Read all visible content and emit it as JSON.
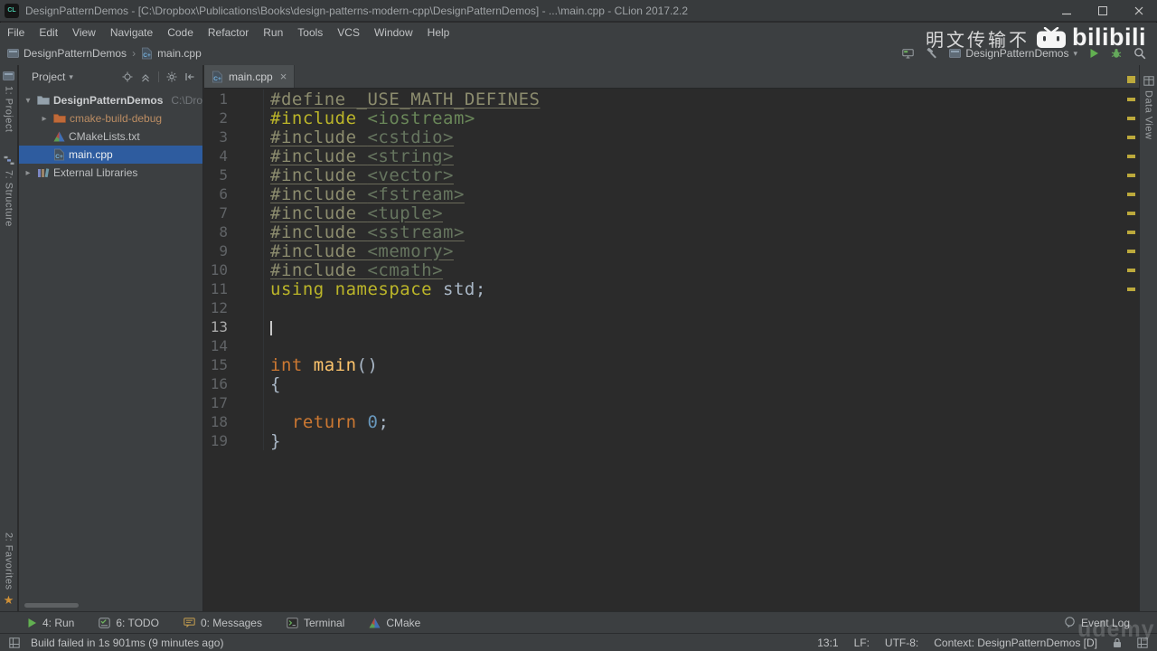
{
  "titlebar": {
    "app_icon_text": "CL",
    "title": "DesignPatternDemos - [C:\\Dropbox\\Publications\\Books\\design-patterns-modern-cpp\\DesignPatternDemos] - ...\\main.cpp - CLion 2017.2.2"
  },
  "menubar": {
    "items": [
      "File",
      "Edit",
      "View",
      "Navigate",
      "Code",
      "Refactor",
      "Run",
      "Tools",
      "VCS",
      "Window",
      "Help"
    ]
  },
  "navbar": {
    "breadcrumbs": [
      {
        "label": "DesignPatternDemos",
        "icon": "project"
      },
      {
        "label": "main.cpp",
        "icon": "cpp-file"
      }
    ],
    "run_config_label": "DesignPatternDemos"
  },
  "overlays": {
    "cjk_watermark": "明文传输不",
    "bilibili_text": "bilibili",
    "udemy_text": "udemy"
  },
  "tool_stripes": {
    "left": [
      {
        "label": "1: Project",
        "icon": "project"
      },
      {
        "label": "7: Structure",
        "icon": "structure"
      }
    ],
    "left_bottom": [
      {
        "label": "2: Favorites",
        "icon": "star"
      }
    ],
    "right": [
      {
        "label": "Data View",
        "icon": "dataview"
      }
    ]
  },
  "project_panel": {
    "title": "Project",
    "tree": [
      {
        "label": "DesignPatternDemos",
        "hint": "C:\\Drop",
        "icon": "folder",
        "arrow": "expanded",
        "indent": 0,
        "bold": true
      },
      {
        "label": "cmake-build-debug",
        "icon": "folder-excluded",
        "arrow": "collapsed",
        "indent": 1,
        "label_color": "#bc8d63"
      },
      {
        "label": "CMakeLists.txt",
        "icon": "cmake",
        "arrow": "none",
        "indent": 1
      },
      {
        "label": "main.cpp",
        "icon": "cpp-file",
        "arrow": "none",
        "indent": 1,
        "selected": true
      },
      {
        "label": "External Libraries",
        "icon": "library",
        "arrow": "collapsed",
        "indent": 0
      }
    ]
  },
  "editor": {
    "tabs": [
      {
        "label": "main.cpp",
        "icon": "cpp-file",
        "active": true
      }
    ],
    "caret_line": 13,
    "warning_lines": [
      1,
      2,
      3,
      4,
      5,
      6,
      7,
      8,
      9,
      10,
      11
    ],
    "code": [
      {
        "n": 1,
        "tokens": [
          {
            "t": "#define _USE_MATH_DEFINES",
            "s": "ppd",
            "u": true
          }
        ]
      },
      {
        "n": 2,
        "tokens": [
          {
            "t": "#include ",
            "s": "pp"
          },
          {
            "t": "<iostream>",
            "s": "str"
          }
        ]
      },
      {
        "n": 3,
        "tokens": [
          {
            "t": "#include ",
            "s": "ppd",
            "u": true
          },
          {
            "t": "<cstdio>",
            "s": "strd",
            "u": true
          }
        ]
      },
      {
        "n": 4,
        "tokens": [
          {
            "t": "#include ",
            "s": "ppd",
            "u": true
          },
          {
            "t": "<string>",
            "s": "strd",
            "u": true
          }
        ]
      },
      {
        "n": 5,
        "tokens": [
          {
            "t": "#include ",
            "s": "ppd",
            "u": true
          },
          {
            "t": "<vector>",
            "s": "strd",
            "u": true
          }
        ]
      },
      {
        "n": 6,
        "tokens": [
          {
            "t": "#include ",
            "s": "ppd",
            "u": true
          },
          {
            "t": "<fstream>",
            "s": "strd",
            "u": true
          }
        ]
      },
      {
        "n": 7,
        "tokens": [
          {
            "t": "#include ",
            "s": "ppd",
            "u": true
          },
          {
            "t": "<tuple>",
            "s": "strd",
            "u": true
          }
        ]
      },
      {
        "n": 8,
        "tokens": [
          {
            "t": "#include ",
            "s": "ppd",
            "u": true
          },
          {
            "t": "<sstream>",
            "s": "strd",
            "u": true
          }
        ]
      },
      {
        "n": 9,
        "tokens": [
          {
            "t": "#include ",
            "s": "ppd",
            "u": true
          },
          {
            "t": "<memory>",
            "s": "strd",
            "u": true
          }
        ]
      },
      {
        "n": 10,
        "tokens": [
          {
            "t": "#include ",
            "s": "ppd",
            "u": true
          },
          {
            "t": "<cmath>",
            "s": "strd",
            "u": true
          }
        ]
      },
      {
        "n": 11,
        "tokens": [
          {
            "t": "using",
            "s": "pp"
          },
          {
            "t": " ",
            "s": "pl"
          },
          {
            "t": "namespace",
            "s": "pp"
          },
          {
            "t": " std;",
            "s": "pl"
          }
        ]
      },
      {
        "n": 12,
        "tokens": []
      },
      {
        "n": 13,
        "tokens": []
      },
      {
        "n": 14,
        "tokens": []
      },
      {
        "n": 15,
        "tokens": [
          {
            "t": "int",
            "s": "kw"
          },
          {
            "t": " ",
            "s": "pl"
          },
          {
            "t": "main",
            "s": "fn"
          },
          {
            "t": "()",
            "s": "pl"
          }
        ]
      },
      {
        "n": 16,
        "tokens": [
          {
            "t": "{",
            "s": "pl"
          }
        ]
      },
      {
        "n": 17,
        "tokens": []
      },
      {
        "n": 18,
        "tokens": [
          {
            "t": "  ",
            "s": "pl"
          },
          {
            "t": "return",
            "s": "kw"
          },
          {
            "t": " ",
            "s": "pl"
          },
          {
            "t": "0",
            "s": "num"
          },
          {
            "t": ";",
            "s": "pl"
          }
        ]
      },
      {
        "n": 19,
        "tokens": [
          {
            "t": "}",
            "s": "pl"
          }
        ]
      }
    ]
  },
  "syntax_colors": {
    "pp": "#BBB529",
    "str": "#6A8759",
    "ppd": "#8C8C6E",
    "strd": "#66755F",
    "kw": "#CC7832",
    "fn": "#FFC66D",
    "num": "#6897BB",
    "pl": "#A9B7C6"
  },
  "bottom_bar": {
    "left": [
      {
        "icon": "run",
        "label": "4: Run"
      },
      {
        "icon": "todo",
        "label": "6: TODO"
      },
      {
        "icon": "messages",
        "label": "0: Messages"
      },
      {
        "icon": "terminal",
        "label": "Terminal"
      },
      {
        "icon": "cmake",
        "label": "CMake"
      }
    ],
    "right": [
      {
        "icon": "event-log",
        "label": "Event Log"
      }
    ]
  },
  "status_bar": {
    "message": "Build failed in 1s 901ms (9 minutes ago)",
    "caret_position": "13:1",
    "line_separator": "LF:",
    "encoding": "UTF-8:",
    "context": "Context: DesignPatternDemos [D]"
  }
}
